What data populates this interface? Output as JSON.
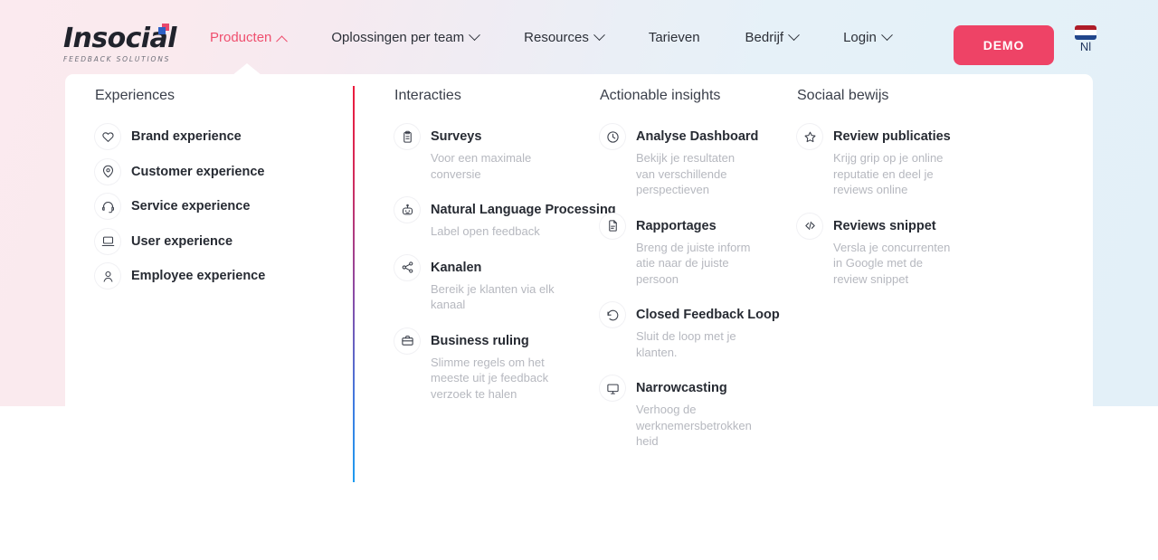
{
  "brand": {
    "logo_word": "Insocial",
    "logo_tagline": "FEEDBACK SOLUTIONS"
  },
  "header": {
    "nav": [
      {
        "label": "Producten",
        "has_chevron": true,
        "chevron": "chevron-up-icon",
        "active": true
      },
      {
        "label": "Oplossingen per team",
        "has_chevron": true,
        "chevron": "chevron-down-icon",
        "active": false
      },
      {
        "label": "Resources",
        "has_chevron": true,
        "chevron": "chevron-down-icon",
        "active": false
      },
      {
        "label": "Tarieven",
        "has_chevron": false,
        "chevron": "",
        "active": false
      },
      {
        "label": "Bedrijf",
        "has_chevron": true,
        "chevron": "chevron-down-icon",
        "active": false
      },
      {
        "label": "Login",
        "has_chevron": true,
        "chevron": "chevron-down-icon",
        "active": false
      }
    ],
    "demo_button": "DEMO",
    "language": "Nl",
    "language_flag": "netherlands-flag-icon"
  },
  "colors": {
    "accent_pink": "#ee4366",
    "nav_active": "#ef4f6e",
    "heading": "#272b33",
    "description": "#b6b8bf",
    "band_left": "#fbeaef",
    "band_right": "#e3f0f8",
    "divider_top": "#ec1c3d",
    "divider_bottom": "#1e9cf0"
  },
  "dropdown": {
    "columns": [
      {
        "title": "Experiences",
        "items": [
          {
            "icon": "heart-icon",
            "name": "Brand experience",
            "desc": ""
          },
          {
            "icon": "location-pin-icon",
            "name": "Customer experience",
            "desc": ""
          },
          {
            "icon": "headset-icon",
            "name": "Service experience",
            "desc": ""
          },
          {
            "icon": "laptop-icon",
            "name": "User experience",
            "desc": ""
          },
          {
            "icon": "person-icon",
            "name": "Employee experience",
            "desc": ""
          }
        ]
      },
      {
        "title": "Interacties",
        "items": [
          {
            "icon": "clipboard-icon",
            "name": "Surveys",
            "desc": "Voor een maximale conversie"
          },
          {
            "icon": "robot-icon",
            "name": "Natural Language Processing",
            "desc": "Label open feedback"
          },
          {
            "icon": "share-nodes-icon",
            "name": "Kanalen",
            "desc": "Bereik je klanten via elk kanaal"
          },
          {
            "icon": "briefcase-icon",
            "name": "Business ruling",
            "desc": "Slimme regels om het meeste uit je feedback verzoek te halen"
          }
        ]
      },
      {
        "title": "Actionable insights",
        "items": [
          {
            "icon": "clock-pie-icon",
            "name": "Analyse Dashboard",
            "desc": "Bekijk je resultaten van verschillende perspectieven"
          },
          {
            "icon": "document-icon",
            "name": "Rapportages",
            "desc": "Breng de juiste inform atie naar de juiste persoon"
          },
          {
            "icon": "refresh-loop-icon",
            "name": "Closed Feedback Loop",
            "desc": "Sluit de loop met je klanten."
          },
          {
            "icon": "monitor-icon",
            "name": "Narrowcasting",
            "desc": "Verhoog de werknemersbetrokken heid"
          }
        ]
      },
      {
        "title": "Sociaal bewijs",
        "items": [
          {
            "icon": "star-icon",
            "name": "Review publicaties",
            "desc": "Krijg grip op je online reputatie en deel je reviews online"
          },
          {
            "icon": "code-brackets-icon",
            "name": "Reviews snippet",
            "desc": "Versla je concurrenten in Google met de review snippet"
          }
        ]
      }
    ]
  }
}
